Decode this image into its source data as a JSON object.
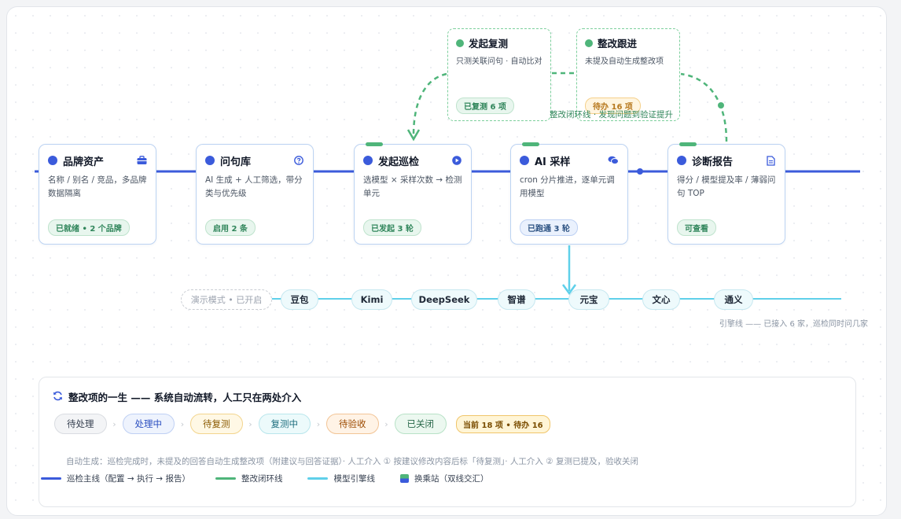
{
  "stages": [
    {
      "title": "品牌资产",
      "desc": "名称 / 别名 / 竞品，多品牌数据隔离",
      "badge": "已就绪 • 2 个品牌",
      "icon": "briefcase-icon",
      "badge_style": "green"
    },
    {
      "title": "问句库",
      "desc": "AI 生成 + 人工筛选，带分类与优先级",
      "badge": "启用 2 条",
      "icon": "question-circle-icon",
      "badge_style": "green"
    },
    {
      "title": "发起巡检",
      "desc": "选模型 × 采样次数 → 检测单元",
      "badge": "已发起 3 轮",
      "icon": "play-icon",
      "badge_style": "green"
    },
    {
      "title": "AI 采样",
      "desc": "cron 分片推进，逐单元调用模型",
      "badge": "已跑通 3 轮",
      "icon": "chat-bubbles-icon",
      "badge_style": "blue"
    },
    {
      "title": "诊断报告",
      "desc": "得分 / 模型提及率 / 薄弱问句 TOP",
      "badge": "可查看",
      "icon": "document-icon",
      "badge_style": "green"
    }
  ],
  "loop_nodes": [
    {
      "title": "发起复测",
      "desc": "只测关联问句 · 自动比对",
      "badge": "已复测 6 项",
      "badge_style": "green"
    },
    {
      "title": "整改跟进",
      "desc": "未提及自动生成整改项",
      "badge": "待办 16 项",
      "badge_style": "orange"
    }
  ],
  "loop_line_label": "整改闭环线 · 发现问题到验证提升",
  "demo_mode": "演示模式 • 已开启",
  "models": [
    "豆包",
    "Kimi",
    "DeepSeek",
    "智谱",
    "元宝",
    "文心",
    "通义"
  ],
  "source_label": "引擎线 —— 已接入 6 家，巡检同时问几家",
  "lifecycle": {
    "title": "整改项的一生 —— 系统自动流转，人工只在两处介入",
    "states": [
      "待处理",
      "处理中",
      "待复测",
      "复测中",
      "待验收",
      "已关闭"
    ],
    "counter": "当前 18 项 • 待办 16",
    "note": "自动生成：巡检完成时，未提及的回答自动生成整改项（附建议与回答证据）· 人工介入 ① 按建议修改内容后标「待复测」· 人工介入 ② 复测已提及，验收关闭",
    "legend": [
      "巡检主线（配置 → 执行 → 报告）",
      "整改闭环线",
      "模型引擎线",
      "换乘站（双线交汇）"
    ]
  },
  "colors": {
    "main_line": "#3b5bdb",
    "loop_line": "#4fb57a",
    "model_line": "#5fd0ea"
  }
}
